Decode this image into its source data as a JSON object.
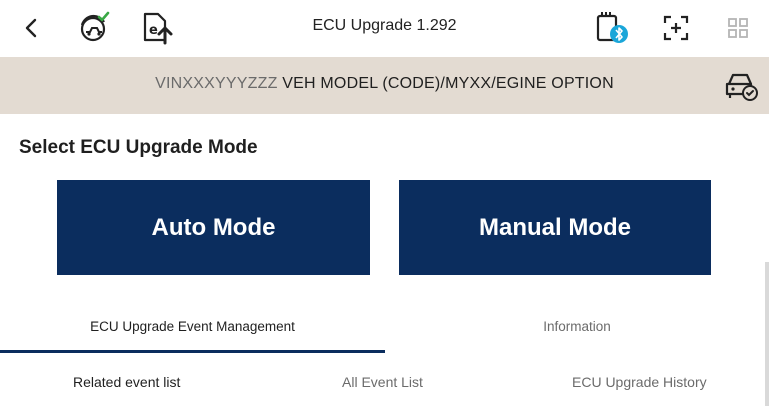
{
  "header": {
    "title": "ECU Upgrade 1.292",
    "icons": [
      "back-icon",
      "vehicle-scan-icon",
      "ecu-upload-icon",
      "vci-bluetooth-icon",
      "screen-capture-icon",
      "grid-menu-icon"
    ]
  },
  "vehicle": {
    "vin": "VINXXXYYYZZZ",
    "info": "VEH MODEL (CODE)/MYXX/EGINE OPTION"
  },
  "section": {
    "title": "Select ECU Upgrade Mode"
  },
  "modes": {
    "auto": "Auto Mode",
    "manual": "Manual Mode"
  },
  "tabs": [
    {
      "label": "ECU Upgrade Event Management",
      "active": true
    },
    {
      "label": "Information",
      "active": false
    }
  ],
  "subtabs": [
    {
      "label": "Related event list",
      "active": true
    },
    {
      "label": "All Event List",
      "active": false
    },
    {
      "label": "ECU Upgrade History",
      "active": false
    }
  ],
  "colors": {
    "primary": "#0b2d5e",
    "vin_bar": "#e3dbd2",
    "bluetooth": "#1aa6d9",
    "check_green": "#39a845"
  }
}
